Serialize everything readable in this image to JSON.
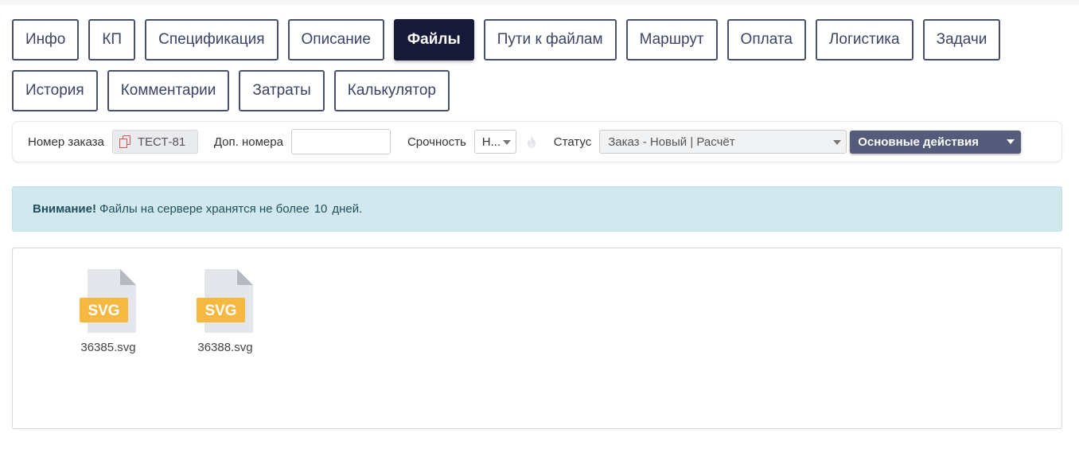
{
  "tabs": [
    [
      {
        "label": "Инфо",
        "active": false
      },
      {
        "label": "КП",
        "active": false
      },
      {
        "label": "Спецификация",
        "active": false
      },
      {
        "label": "Описание",
        "active": false
      },
      {
        "label": "Файлы",
        "active": true
      },
      {
        "label": "Пути к файлам",
        "active": false
      },
      {
        "label": "Маршрут",
        "active": false
      },
      {
        "label": "Оплата",
        "active": false
      },
      {
        "label": "Логистика",
        "active": false
      },
      {
        "label": "Задачи",
        "active": false
      }
    ],
    [
      {
        "label": "История",
        "active": false
      },
      {
        "label": "Комментарии",
        "active": false
      },
      {
        "label": "Затраты",
        "active": false
      },
      {
        "label": "Калькулятор",
        "active": false
      }
    ]
  ],
  "order": {
    "number_label": "Номер заказа",
    "number_value": "ТЕСТ-81",
    "extra_label": "Доп. номера",
    "extra_value": "",
    "urgency_label": "Срочность",
    "urgency_value": "Н...",
    "status_label": "Статус",
    "status_value": "Заказ - Новый | Расчёт",
    "actions_label": "Основные действия"
  },
  "alert": {
    "strong": "Внимание!",
    "text_before": "Файлы на сервере хранятся не более",
    "days": "10",
    "text_after": "дней."
  },
  "files": [
    {
      "name": "36385.svg",
      "ext": "SVG"
    },
    {
      "name": "36388.svg",
      "ext": "SVG"
    }
  ],
  "colors": {
    "tab_active_bg": "#161a38",
    "tab_border": "#4a5168",
    "actions_bg": "#555b7a",
    "alert_bg": "#d1e9ee",
    "file_badge": "#f5b942"
  }
}
